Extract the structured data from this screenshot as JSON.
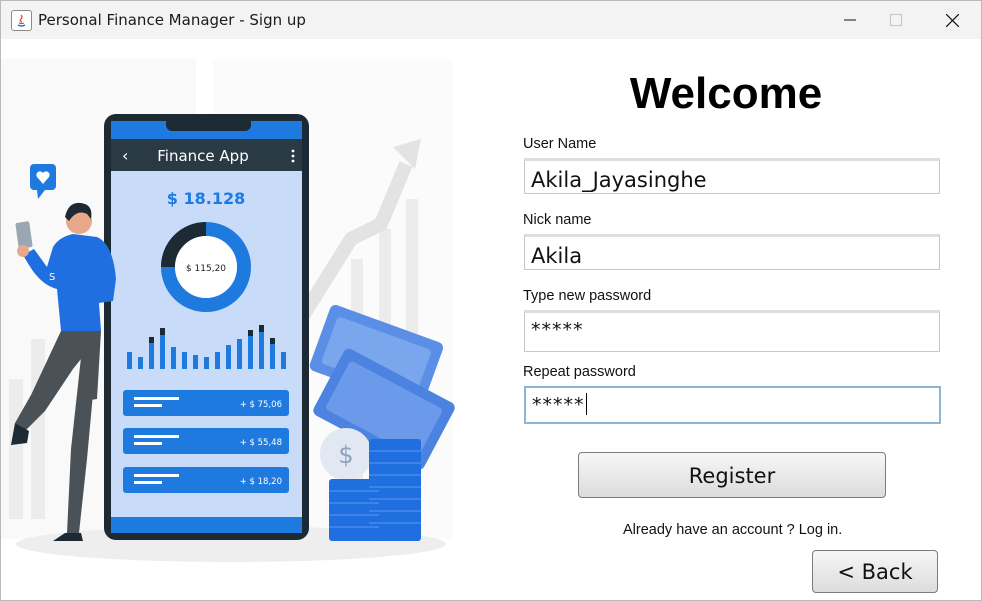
{
  "window": {
    "title": "Personal Finance Manager - Sign up",
    "controls": [
      "minimize",
      "maximize",
      "close"
    ]
  },
  "illustration": {
    "app_title": "Finance App",
    "balance": "$ 18.128",
    "donut_value": "$ 115,20",
    "transactions": [
      "+ $ 75,06",
      "+ $ 55,48",
      "+ $ 18,20"
    ]
  },
  "form": {
    "heading": "Welcome",
    "username": {
      "label": "User Name",
      "value": "Akila_Jayasinghe"
    },
    "nickname": {
      "label": "Nick name",
      "value": "Akila"
    },
    "new_password": {
      "label": "Type new password",
      "value": "*****"
    },
    "repeat_password": {
      "label": "Repeat password",
      "value": "*****"
    },
    "register_label": "Register",
    "login_prompt": "Already have an account ? Log in.",
    "back_label": "< Back"
  },
  "colors": {
    "accent_blue": "#1f7ae0",
    "phone_frame": "#1d2a33",
    "focus_border": "#8cb5da"
  }
}
